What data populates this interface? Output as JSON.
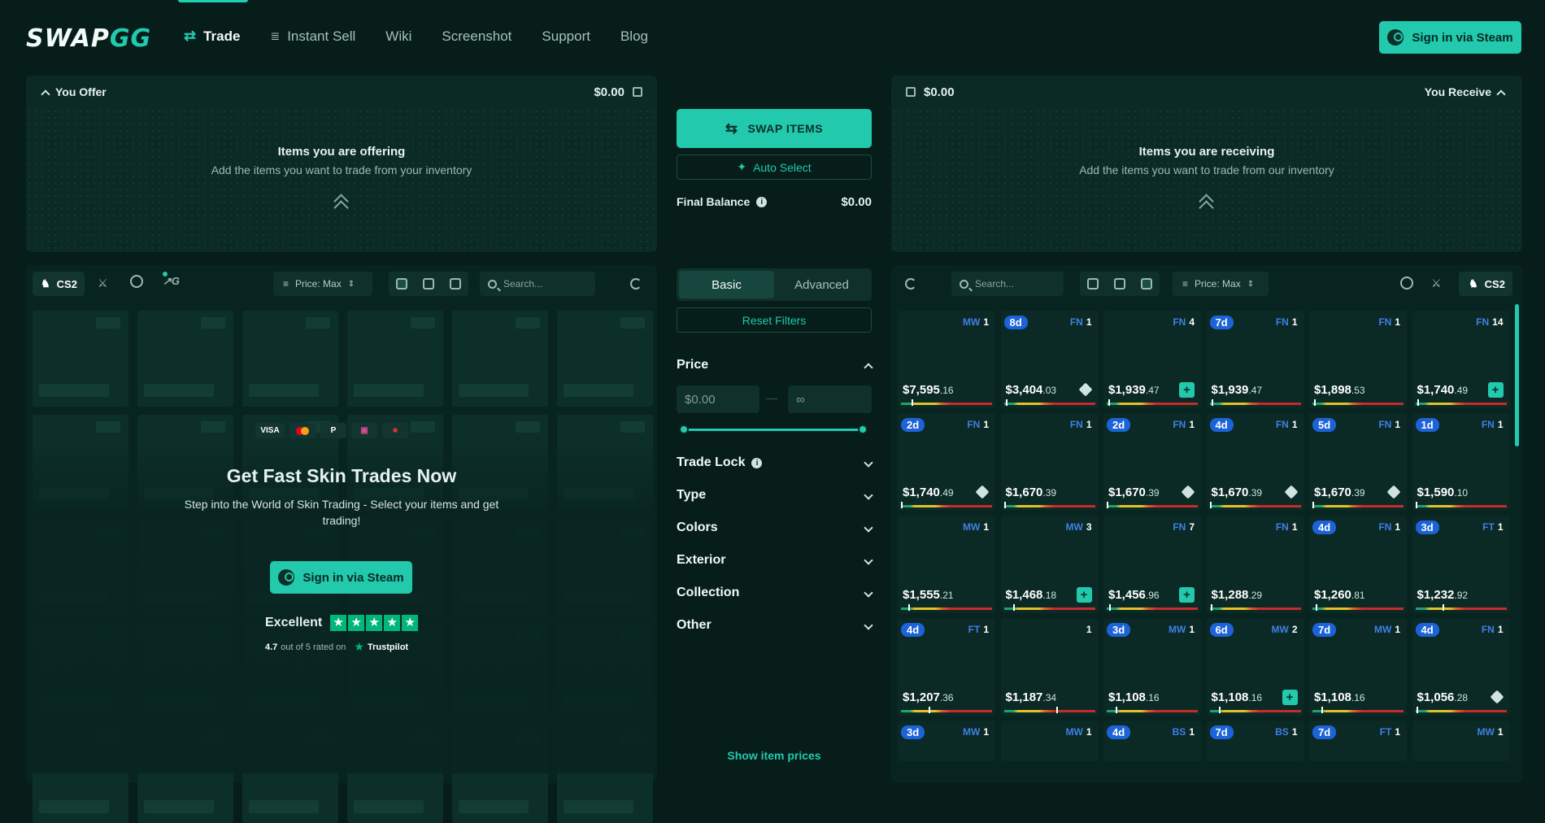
{
  "header": {
    "logo": "SWAP",
    "logo_accent": "GG",
    "nav": [
      {
        "label": "Trade",
        "icon": "swap-arrows-icon",
        "active": true
      },
      {
        "label": "Instant Sell",
        "icon": "coins-stack-icon",
        "active": false
      },
      {
        "label": "Wiki",
        "active": false
      },
      {
        "label": "Screenshot",
        "active": false
      },
      {
        "label": "Support",
        "active": false
      },
      {
        "label": "Blog",
        "active": false
      }
    ],
    "signin_label": "Sign in via Steam"
  },
  "offer": {
    "title": "You Offer",
    "amount": "$0.00",
    "heading": "Items you are offering",
    "sub": "Add the items you want to trade from your inventory"
  },
  "receive": {
    "title": "You Receive",
    "amount": "$0.00",
    "heading": "Items you are receiving",
    "sub": "Add the items you want to trade from our inventory"
  },
  "center": {
    "swap_label": "SWAP ITEMS",
    "auto_label": "Auto Select",
    "balance_label": "Final Balance",
    "balance_value": "$0.00",
    "tabs": [
      "Basic",
      "Advanced"
    ],
    "reset_label": "Reset Filters",
    "price_label": "Price",
    "price_min": "$0.00",
    "price_max": "∞",
    "filters": [
      "Trade Lock",
      "Type",
      "Colors",
      "Exterior",
      "Collection",
      "Other"
    ],
    "show_prices": "Show item prices"
  },
  "left_toolbar": {
    "game": "CS2",
    "sort": "Price: Max",
    "search_placeholder": "Search..."
  },
  "right_toolbar": {
    "game": "CS2",
    "sort": "Price: Max",
    "search_placeholder": "Search..."
  },
  "promo": {
    "payments": [
      "VISA",
      "mastercard",
      "paypal",
      "skrill",
      "lock"
    ],
    "title": "Get Fast Skin Trades Now",
    "line1": "Step into the World of Skin Trading - Select your items and get",
    "line2": "trading!",
    "signin_label": "Sign in via Steam",
    "rating_word": "Excellent",
    "score": "4.7",
    "rated_text": "out of 5 rated on",
    "trustpilot": "Trustpilot"
  },
  "colors": {
    "accent": "#22c9ad",
    "bg": "#061d1a",
    "panel": "#0b2a25",
    "lock_badge": "#1c63d9"
  },
  "items": [
    {
      "days": "",
      "wear": "MW",
      "qty": "1",
      "dollars": "$7,595",
      "cents": ".16",
      "wear_pct": 0.12,
      "action": "none"
    },
    {
      "days": "8d",
      "wear": "FN",
      "qty": "1",
      "dollars": "$3,404",
      "cents": ".03",
      "wear_pct": 0.02,
      "action": "tag"
    },
    {
      "days": "",
      "wear": "FN",
      "qty": "4",
      "dollars": "$1,939",
      "cents": ".47",
      "wear_pct": 0.02,
      "action": "plus"
    },
    {
      "days": "7d",
      "wear": "FN",
      "qty": "1",
      "dollars": "$1,939",
      "cents": ".47",
      "wear_pct": 0.02,
      "action": "none"
    },
    {
      "days": "",
      "wear": "FN",
      "qty": "1",
      "dollars": "$1,898",
      "cents": ".53",
      "wear_pct": 0.02,
      "action": "none"
    },
    {
      "days": "",
      "wear": "FN",
      "qty": "14",
      "dollars": "$1,740",
      "cents": ".49",
      "wear_pct": 0.02,
      "action": "plus"
    },
    {
      "days": "2d",
      "wear": "FN",
      "qty": "1",
      "dollars": "$1,740",
      "cents": ".49",
      "wear_pct": 0.0,
      "action": "tag"
    },
    {
      "days": "",
      "wear": "FN",
      "qty": "1",
      "dollars": "$1,670",
      "cents": ".39",
      "wear_pct": 0.0,
      "action": "none"
    },
    {
      "days": "2d",
      "wear": "FN",
      "qty": "1",
      "dollars": "$1,670",
      "cents": ".39",
      "wear_pct": 0.0,
      "action": "tag"
    },
    {
      "days": "4d",
      "wear": "FN",
      "qty": "1",
      "dollars": "$1,670",
      "cents": ".39",
      "wear_pct": 0.0,
      "action": "tag"
    },
    {
      "days": "5d",
      "wear": "FN",
      "qty": "1",
      "dollars": "$1,670",
      "cents": ".39",
      "wear_pct": 0.0,
      "action": "tag"
    },
    {
      "days": "1d",
      "wear": "FN",
      "qty": "1",
      "dollars": "$1,590",
      "cents": ".10",
      "wear_pct": 0.0,
      "action": "none"
    },
    {
      "days": "",
      "wear": "MW",
      "qty": "1",
      "dollars": "$1,555",
      "cents": ".21",
      "wear_pct": 0.08,
      "action": "none"
    },
    {
      "days": "",
      "wear": "MW",
      "qty": "3",
      "dollars": "$1,468",
      "cents": ".18",
      "wear_pct": 0.1,
      "action": "plus"
    },
    {
      "days": "",
      "wear": "FN",
      "qty": "7",
      "dollars": "$1,456",
      "cents": ".96",
      "wear_pct": 0.03,
      "action": "plus"
    },
    {
      "days": "",
      "wear": "FN",
      "qty": "1",
      "dollars": "$1,288",
      "cents": ".29",
      "wear_pct": 0.01,
      "action": "none"
    },
    {
      "days": "4d",
      "wear": "FN",
      "qty": "1",
      "dollars": "$1,260",
      "cents": ".81",
      "wear_pct": 0.04,
      "action": "none"
    },
    {
      "days": "3d",
      "wear": "FT",
      "qty": "1",
      "dollars": "$1,232",
      "cents": ".92",
      "wear_pct": 0.3,
      "action": "none"
    },
    {
      "days": "4d",
      "wear": "FT",
      "qty": "1",
      "dollars": "$1,207",
      "cents": ".36",
      "wear_pct": 0.3,
      "action": "none"
    },
    {
      "days": "",
      "wear": "",
      "qty": "1",
      "dollars": "$1,187",
      "cents": ".34",
      "wear_pct": 0.58,
      "action": "none"
    },
    {
      "days": "3d",
      "wear": "MW",
      "qty": "1",
      "dollars": "$1,108",
      "cents": ".16",
      "wear_pct": 0.1,
      "action": "none"
    },
    {
      "days": "6d",
      "wear": "MW",
      "qty": "2",
      "dollars": "$1,108",
      "cents": ".16",
      "wear_pct": 0.1,
      "action": "plus"
    },
    {
      "days": "7d",
      "wear": "MW",
      "qty": "1",
      "dollars": "$1,108",
      "cents": ".16",
      "wear_pct": 0.1,
      "action": "none"
    },
    {
      "days": "4d",
      "wear": "FN",
      "qty": "1",
      "dollars": "$1,056",
      "cents": ".28",
      "wear_pct": 0.01,
      "action": "tag"
    },
    {
      "days": "3d",
      "wear": "MW",
      "qty": "1",
      "dollars": "",
      "cents": "",
      "wear_pct": null,
      "action": "none"
    },
    {
      "days": "",
      "wear": "MW",
      "qty": "1",
      "dollars": "",
      "cents": "",
      "wear_pct": null,
      "action": "none"
    },
    {
      "days": "4d",
      "wear": "BS",
      "qty": "1",
      "dollars": "",
      "cents": "",
      "wear_pct": null,
      "action": "none"
    },
    {
      "days": "7d",
      "wear": "BS",
      "qty": "1",
      "dollars": "",
      "cents": "",
      "wear_pct": null,
      "action": "none"
    },
    {
      "days": "7d",
      "wear": "FT",
      "qty": "1",
      "dollars": "",
      "cents": "",
      "wear_pct": null,
      "action": "none"
    },
    {
      "days": "",
      "wear": "MW",
      "qty": "1",
      "dollars": "",
      "cents": "",
      "wear_pct": null,
      "action": "none"
    }
  ]
}
